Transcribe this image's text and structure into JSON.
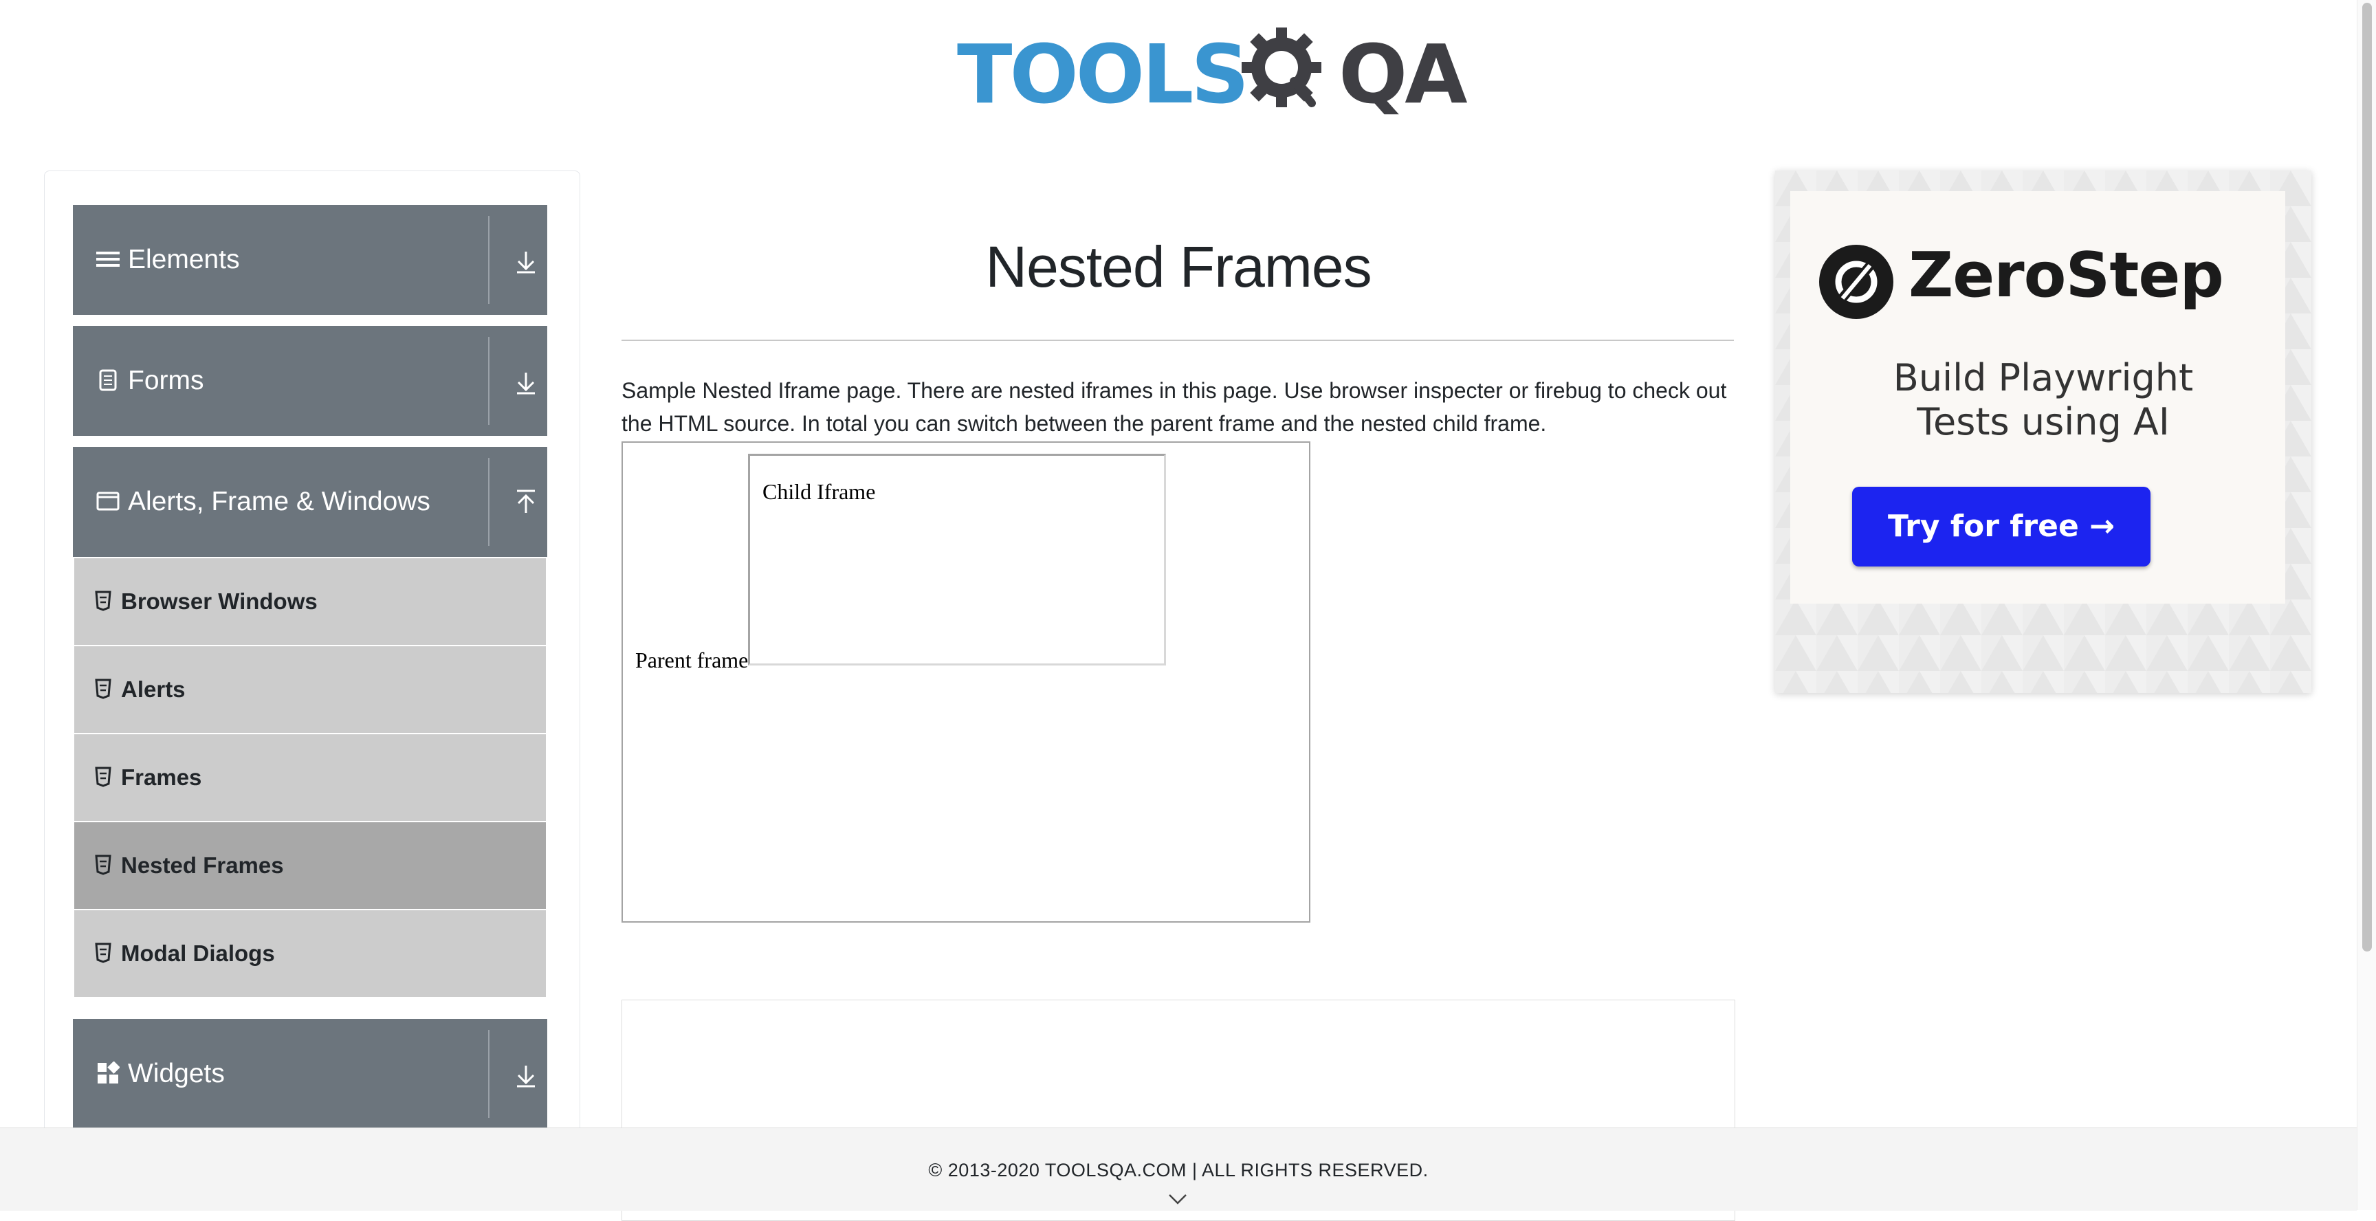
{
  "header": {
    "logo_text_tools": "TOOLS",
    "logo_text_qa": "QA",
    "logo_colors": {
      "tools": "#3a95d0",
      "qa": "#3f3f44"
    }
  },
  "sidebar": {
    "groups": [
      {
        "label": "Elements",
        "icon": "list-icon",
        "arrow": "download-arrow-icon"
      },
      {
        "label": "Forms",
        "icon": "form-icon",
        "arrow": "download-arrow-icon"
      },
      {
        "label": "Alerts, Frame & Windows",
        "icon": "window-icon",
        "arrow": "upload-arrow-icon"
      },
      {
        "label": "Widgets",
        "icon": "widgets-icon",
        "arrow": "download-arrow-icon"
      }
    ],
    "items": [
      {
        "label": "Browser Windows",
        "icon": "html5-icon",
        "active": false
      },
      {
        "label": "Alerts",
        "icon": "html5-icon",
        "active": false
      },
      {
        "label": "Frames",
        "icon": "html5-icon",
        "active": false
      },
      {
        "label": "Nested Frames",
        "icon": "html5-icon",
        "active": true
      },
      {
        "label": "Modal Dialogs",
        "icon": "html5-icon",
        "active": false
      }
    ],
    "colors": {
      "group_bg": "#6c757d",
      "item_bg": "#cccccc",
      "item_active_bg": "#a8a8a8"
    }
  },
  "main": {
    "title": "Nested Frames",
    "intro": "Sample Nested Iframe page. There are nested iframes in this page. Use browser inspecter or firebug to check out the HTML source. In total you can switch between the parent frame and the nested child frame.",
    "parent_frame_label": "Parent frame",
    "child_frame_label": "Child Iframe"
  },
  "ad": {
    "brand": "ZeroStep",
    "headline": "Build Playwright Tests using AI",
    "cta": "Try for free →",
    "cta_color": "#1c24f0"
  },
  "footer": {
    "text": "© 2013-2020 TOOLSQA.COM | ALL RIGHTS RESERVED."
  }
}
